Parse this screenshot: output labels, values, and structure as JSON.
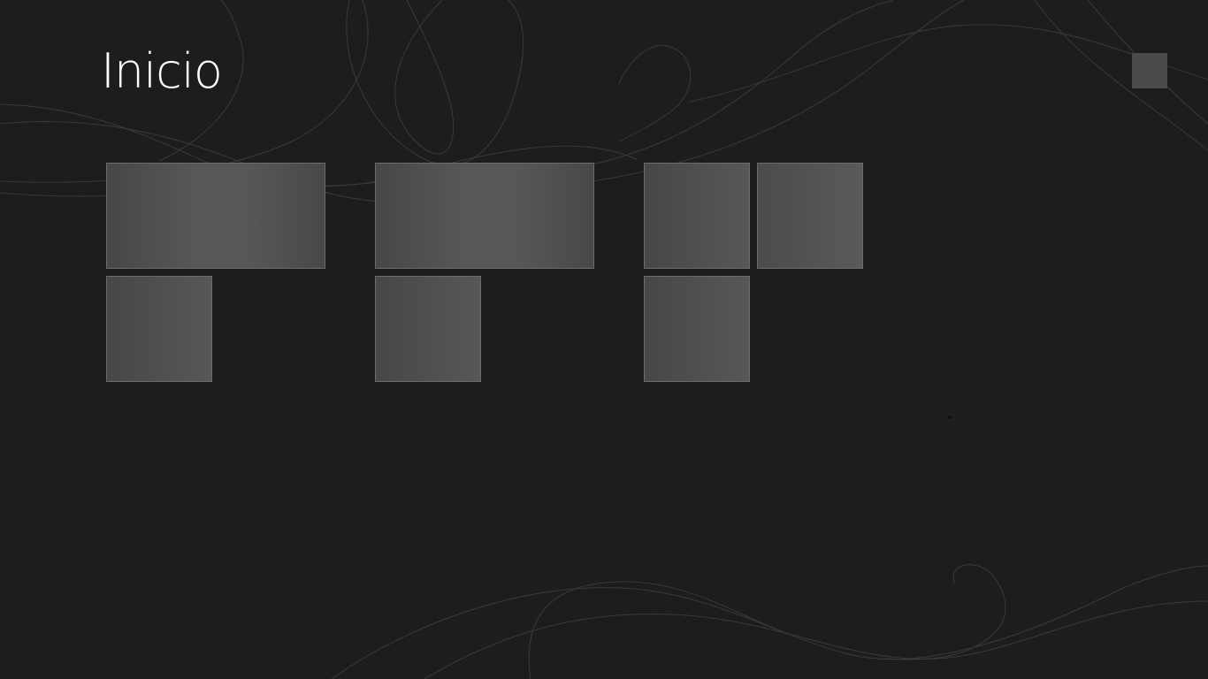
{
  "screen": {
    "title": "Inicio"
  },
  "tile_groups": [
    {
      "group": 1,
      "tiles": [
        {
          "size": "wide"
        },
        {
          "size": "square"
        }
      ]
    },
    {
      "group": 2,
      "tiles": [
        {
          "size": "wide"
        },
        {
          "size": "square"
        }
      ]
    },
    {
      "group": 3,
      "tiles": [
        {
          "size": "square"
        },
        {
          "size": "square"
        },
        {
          "size": "square"
        }
      ]
    }
  ],
  "colors": {
    "background": "#1d1d1d",
    "tile_fill": "#555555",
    "tile_border": "#6c6c6c",
    "title_text": "#ffffff",
    "swirl": "#3a3a3a"
  },
  "icons": {
    "user_account": "user-avatar-icon"
  }
}
